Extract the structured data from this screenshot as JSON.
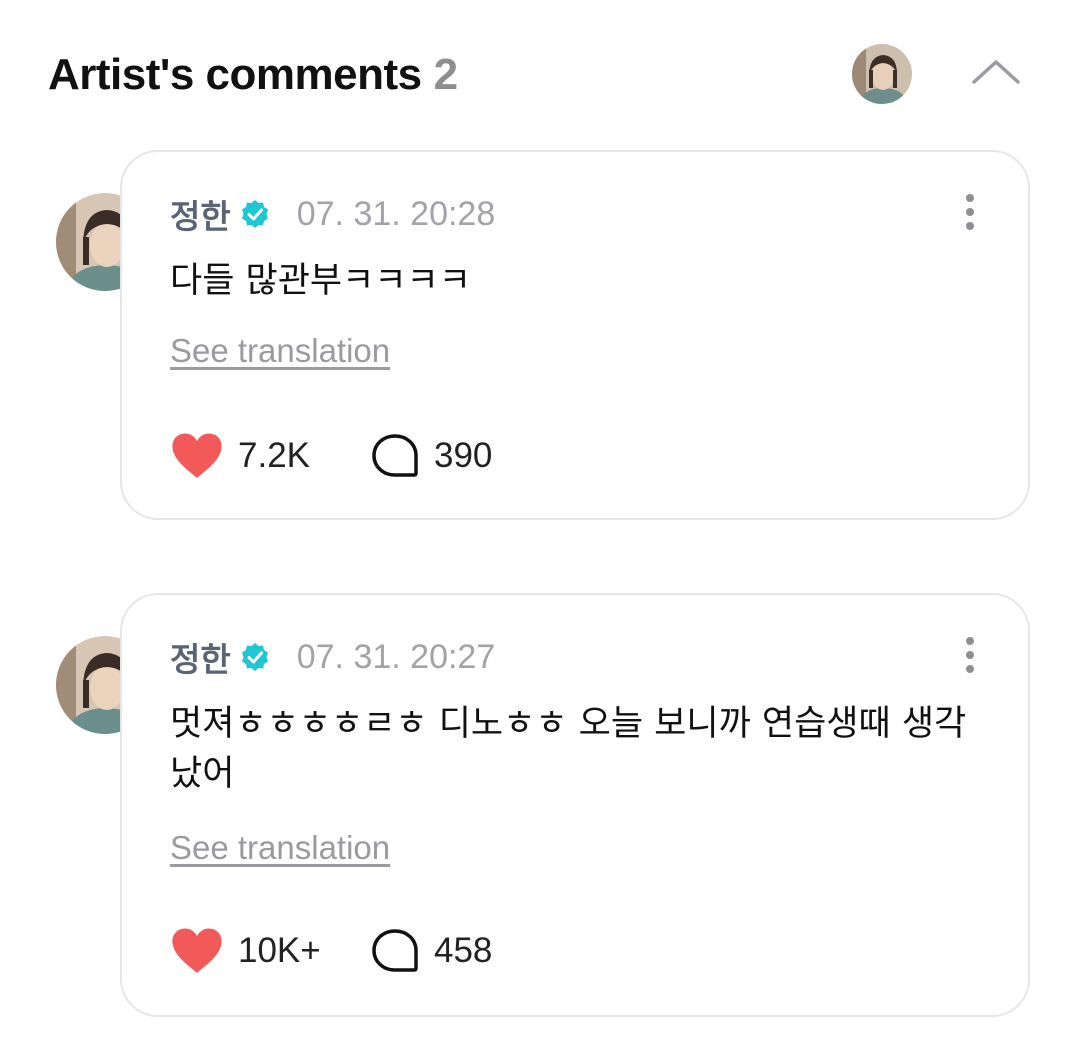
{
  "header": {
    "title": "Artist's comments",
    "count": "2"
  },
  "comments": [
    {
      "author": "정한",
      "timestamp": "07. 31. 20:28",
      "body": "다들 많관부ㅋㅋㅋㅋ",
      "translate_label": "See translation",
      "likes": "7.2K",
      "replies": "390"
    },
    {
      "author": "정한",
      "timestamp": "07. 31. 20:27",
      "body": "멋져ㅎㅎㅎㅎㄹㅎ 디노ㅎㅎ 오늘 보니까 연습생때 생각났어",
      "translate_label": "See translation",
      "likes": "10K+",
      "replies": "458"
    }
  ],
  "colors": {
    "heart": "#f25a5a",
    "verified": "#1fc6d4",
    "muted_text": "#a2a2a8",
    "card_border": "#e6e6ea"
  },
  "icons": {
    "verified": "verified-badge-icon",
    "like": "heart-icon",
    "reply": "speech-bubble-icon",
    "more": "more-vertical-icon",
    "collapse": "chevron-up-icon"
  }
}
